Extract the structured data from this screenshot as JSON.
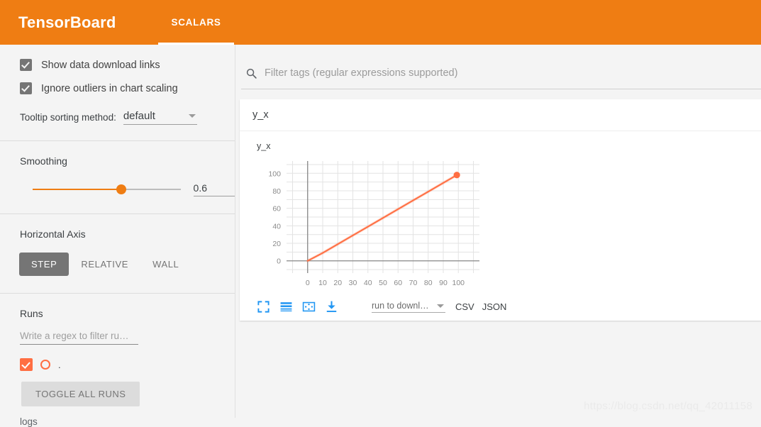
{
  "header": {
    "brand": "TensorBoard",
    "tabs": [
      {
        "label": "SCALARS",
        "active": true
      }
    ]
  },
  "sidebar": {
    "checkboxes": [
      {
        "label": "Show data download links",
        "checked": true
      },
      {
        "label": "Ignore outliers in chart scaling",
        "checked": true
      }
    ],
    "tooltip_sorting": {
      "label": "Tooltip sorting method:",
      "value": "default",
      "icon": "chevron-down-icon"
    },
    "smoothing": {
      "title": "Smoothing",
      "value": "0.6",
      "fill_percent": 60
    },
    "horizontal_axis": {
      "title": "Horizontal Axis",
      "options": [
        "STEP",
        "RELATIVE",
        "WALL"
      ],
      "selected": "STEP"
    },
    "runs": {
      "title": "Runs",
      "filter_placeholder": "Write a regex to filter ru…",
      "run_items": [
        {
          "name": ".",
          "checked": true
        }
      ],
      "toggle_label": "TOGGLE ALL RUNS",
      "logs_label": "logs"
    }
  },
  "main": {
    "search": {
      "placeholder": "Filter tags (regular expressions supported)",
      "icon": "search-icon"
    },
    "tag_group": {
      "header": "y_x"
    },
    "chart_toolbar": {
      "icons": [
        "fullscreen-icon",
        "data-table-icon",
        "fit-domain-icon",
        "download-icon"
      ],
      "download_select": "run to downl…",
      "download_caret": "chevron-down-icon",
      "csv_label": "CSV",
      "json_label": "JSON"
    },
    "watermark": "https://blog.csdn.net/qq_42011158"
  },
  "colors": {
    "header_orange": "#ef7d13",
    "series_orange": "#ff6e42",
    "toolbar_blue": "#2196f3",
    "page_bg": "#f4f4f4"
  },
  "chart_data": {
    "type": "line",
    "title": "y_x",
    "xlabel": "",
    "ylabel": "",
    "xlim": [
      -14,
      114
    ],
    "ylim": [
      -14,
      114
    ],
    "xticks": [
      0,
      10,
      20,
      30,
      40,
      50,
      60,
      70,
      80,
      90,
      100
    ],
    "yticks": [
      0,
      20,
      40,
      60,
      80,
      100
    ],
    "grid": true,
    "legend": false,
    "series": [
      {
        "name": ".",
        "color": "#ff6e42",
        "x": [
          0,
          10,
          20,
          30,
          40,
          50,
          60,
          70,
          80,
          90,
          99
        ],
        "values": [
          0,
          9,
          19,
          29,
          39,
          49,
          59,
          69,
          79,
          89,
          98
        ],
        "endpoint_marker": {
          "x": 99,
          "y": 98
        }
      }
    ]
  }
}
